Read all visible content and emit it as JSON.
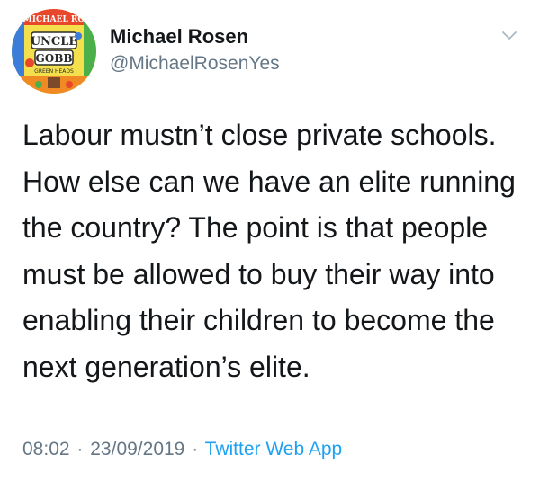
{
  "author": {
    "name": "Michael Rosen",
    "handle": "@MichaelRosenYes",
    "avatar_icon": "book-cover-avatar",
    "avatar_lettering": [
      "MICHAEL RO",
      "UNCLE",
      "GOBB",
      "GREEN HEADS"
    ]
  },
  "menu": {
    "icon": "chevron-down-icon"
  },
  "tweet": {
    "text": "Labour mustn’t close private schools.\nHow else can we have an elite running\nthe country? The point is that people\nmust be allowed to buy their way into\nenabling their children to become the\nnext generation’s elite."
  },
  "meta": {
    "time": "08:02",
    "date": "23/09/2019",
    "separator": "·",
    "source": "Twitter Web App"
  },
  "colors": {
    "text": "#14171a",
    "secondary": "#657786",
    "link": "#1da1f2",
    "background": "#ffffff"
  }
}
